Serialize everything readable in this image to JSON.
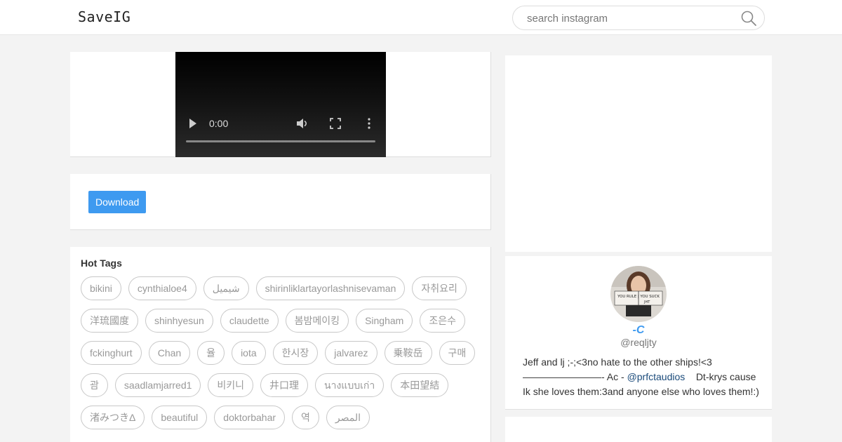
{
  "header": {
    "logo": "SaveIG",
    "search_placeholder": "search instagram"
  },
  "video": {
    "time": "0:00",
    "progress": 0
  },
  "download": {
    "label": "Download"
  },
  "hot_tags": {
    "title": "Hot Tags",
    "tags": [
      "bikini",
      "cynthialoe4",
      "شيميل",
      "shirinliklartayorlashnisevaman",
      "자취요리",
      "洋琉國度",
      "shinhyesun",
      "claudette",
      "봄밤메이킹",
      "Singham",
      "조은수",
      "fckinghurt",
      "Chan",
      "율",
      "iota",
      "한시장",
      "jalvarez",
      "乗鞍岳",
      "구매",
      "괌",
      "saadlamjarred1",
      "비키니",
      "井口理",
      "นางแบบเก่า",
      "本田望結",
      "渚みつきΔ",
      "beautiful",
      "doktorbahar",
      "역",
      "المصر"
    ]
  },
  "profile": {
    "name": "-C",
    "handle": "@reqljty",
    "bio_before_link": "Jeff and lj ;-;<3no hate to the other ships!<3 ————————- Ac - ",
    "bio_link": "@prfctaudios",
    "bio_after_link": "    Dt-krys cause Ik she loves them:3and anyone else who loves them!:)",
    "avatar_sign_text": "YOU RULE | YOU SUCK",
    "avatar_tally": "JHT"
  },
  "colors": {
    "accent": "#3e9af0",
    "link": "#1a4a7a",
    "page_bg": "#f3f3f3"
  }
}
